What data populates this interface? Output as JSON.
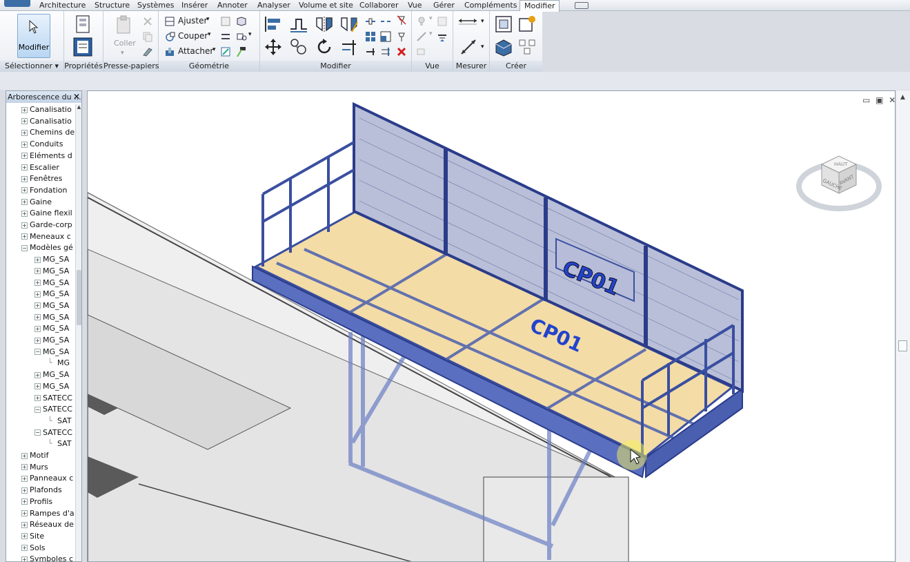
{
  "menu_tabs": [
    "Architecture",
    "Structure",
    "Systèmes",
    "Insérer",
    "Annoter",
    "Analyser",
    "Volume et site",
    "Collaborer",
    "Vue",
    "Gérer",
    "Compléments",
    "Modifier"
  ],
  "active_tab": "Modifier",
  "ribbon": {
    "modifier_button": "Modifier",
    "coller": "Coller",
    "ajuster": "Ajuster",
    "couper": "Couper",
    "attacher": "Attacher",
    "panels": {
      "selectionner": "Sélectionner ▾",
      "proprietes": "Propriétés",
      "presse_papiers": "Presse-papiers",
      "geometrie": "Géométrie",
      "modifier": "Modifier",
      "vue": "Vue",
      "mesurer": "Mesurer",
      "creer": "Créer"
    }
  },
  "browser": {
    "title": "Arborescence du ...",
    "items": [
      {
        "label": "Canalisatio",
        "level": 0,
        "exp": "+"
      },
      {
        "label": "Canalisatio",
        "level": 0,
        "exp": "+"
      },
      {
        "label": "Chemins de",
        "level": 0,
        "exp": "+"
      },
      {
        "label": "Conduits",
        "level": 0,
        "exp": "+"
      },
      {
        "label": "Eléments d",
        "level": 0,
        "exp": "+"
      },
      {
        "label": "Escalier",
        "level": 0,
        "exp": "+"
      },
      {
        "label": "Fenêtres",
        "level": 0,
        "exp": "+"
      },
      {
        "label": "Fondation",
        "level": 0,
        "exp": "+"
      },
      {
        "label": "Gaine",
        "level": 0,
        "exp": "+"
      },
      {
        "label": "Gaine flexil",
        "level": 0,
        "exp": "+"
      },
      {
        "label": "Garde-corp",
        "level": 0,
        "exp": "+"
      },
      {
        "label": "Meneaux c",
        "level": 0,
        "exp": "+"
      },
      {
        "label": "Modèles gé",
        "level": 0,
        "exp": "−"
      },
      {
        "label": "MG_SA",
        "level": 1,
        "exp": "+"
      },
      {
        "label": "MG_SA",
        "level": 1,
        "exp": "+"
      },
      {
        "label": "MG_SA",
        "level": 1,
        "exp": "+"
      },
      {
        "label": "MG_SA",
        "level": 1,
        "exp": "+"
      },
      {
        "label": "MG_SA",
        "level": 1,
        "exp": "+"
      },
      {
        "label": "MG_SA",
        "level": 1,
        "exp": "+"
      },
      {
        "label": "MG_SA",
        "level": 1,
        "exp": "+"
      },
      {
        "label": "MG_SA",
        "level": 1,
        "exp": "+"
      },
      {
        "label": "MG_SA",
        "level": 1,
        "exp": "−"
      },
      {
        "label": "MG",
        "level": 2,
        "exp": ""
      },
      {
        "label": "MG_SA",
        "level": 1,
        "exp": "+"
      },
      {
        "label": "MG_SA",
        "level": 1,
        "exp": "+"
      },
      {
        "label": "SATECC",
        "level": 1,
        "exp": "+"
      },
      {
        "label": "SATECC",
        "level": 1,
        "exp": "−"
      },
      {
        "label": "SAT",
        "level": 2,
        "exp": ""
      },
      {
        "label": "SATECC",
        "level": 1,
        "exp": "−"
      },
      {
        "label": "SAT",
        "level": 2,
        "exp": ""
      },
      {
        "label": "Motif",
        "level": 0,
        "exp": "+"
      },
      {
        "label": "Murs",
        "level": 0,
        "exp": "+"
      },
      {
        "label": "Panneaux c",
        "level": 0,
        "exp": "+"
      },
      {
        "label": "Plafonds",
        "level": 0,
        "exp": "+"
      },
      {
        "label": "Profils",
        "level": 0,
        "exp": "+"
      },
      {
        "label": "Rampes d'a",
        "level": 0,
        "exp": "+"
      },
      {
        "label": "Réseaux de",
        "level": 0,
        "exp": "+"
      },
      {
        "label": "Site",
        "level": 0,
        "exp": "+"
      },
      {
        "label": "Sols",
        "level": 0,
        "exp": "+"
      },
      {
        "label": "Symboles c",
        "level": 0,
        "exp": "+"
      }
    ]
  },
  "viewcube": {
    "top": "HAUT",
    "left": "GAUCHE",
    "front": "AVANT"
  },
  "model_labels": {
    "sign": "CP01",
    "floor": "CP01"
  },
  "view_controls": "▭ ▣ ✕",
  "colors": {
    "model": "#3a4fa0",
    "deck": "#f3dca6",
    "accent": "#2244cc"
  }
}
